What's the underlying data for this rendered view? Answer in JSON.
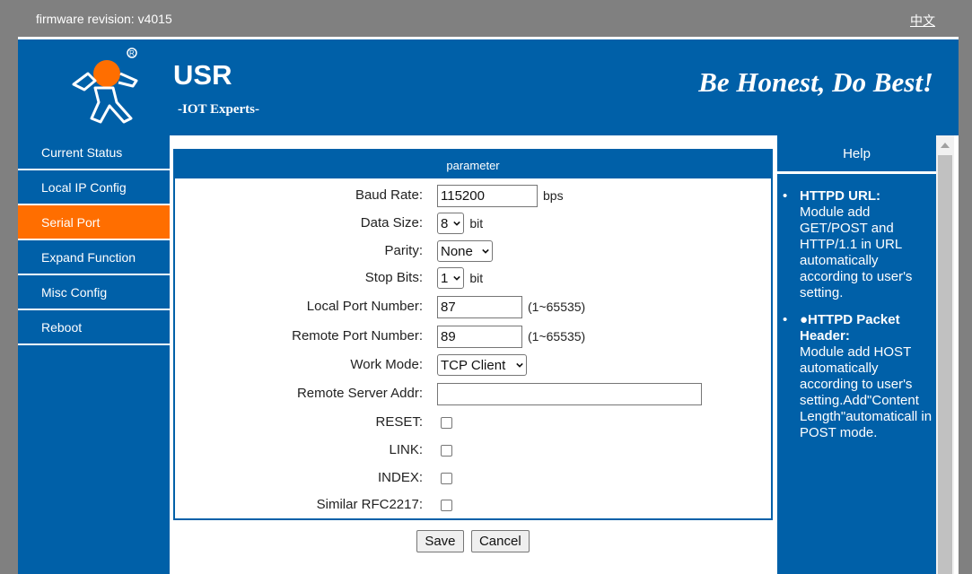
{
  "topbar": {
    "firmware_label": "firmware revision:",
    "firmware_value": "v4015",
    "language_link": "中文"
  },
  "banner": {
    "brand": "USR",
    "tagline": "-IOT Experts-",
    "slogan": "Be Honest, Do Best!",
    "logo_icon": "usr-runner-logo"
  },
  "sidebar": {
    "items": [
      {
        "label": "Current Status",
        "active": false
      },
      {
        "label": "Local IP Config",
        "active": false
      },
      {
        "label": "Serial Port",
        "active": true
      },
      {
        "label": "Expand Function",
        "active": false
      },
      {
        "label": "Misc Config",
        "active": false
      },
      {
        "label": "Reboot",
        "active": false
      }
    ],
    "active_color": "#ff6e00",
    "color": "#0060a8"
  },
  "form": {
    "title": "parameter",
    "baud_rate": {
      "label": "Baud Rate:",
      "value": "115200",
      "unit": "bps"
    },
    "data_size": {
      "label": "Data Size:",
      "value": "8",
      "unit": "bit"
    },
    "parity": {
      "label": "Parity:",
      "value": "None"
    },
    "stop_bits": {
      "label": "Stop Bits:",
      "value": "1",
      "unit": "bit"
    },
    "local_port": {
      "label": "Local Port Number:",
      "value": "87",
      "range": "(1~65535)"
    },
    "remote_port": {
      "label": "Remote Port Number:",
      "value": "89",
      "range": "(1~65535)"
    },
    "work_mode": {
      "label": "Work Mode:",
      "value": "TCP Client"
    },
    "remote_server": {
      "label": "Remote Server Addr:",
      "value": ""
    },
    "reset": {
      "label": "RESET:",
      "checked": false
    },
    "link": {
      "label": "LINK:",
      "checked": false
    },
    "index": {
      "label": "INDEX:",
      "checked": false
    },
    "rfc2217": {
      "label": "Similar RFC2217:",
      "checked": false
    },
    "save_label": "Save",
    "cancel_label": "Cancel"
  },
  "help": {
    "title": "Help",
    "items": [
      {
        "title": "HTTPD URL:",
        "body": "Module add GET/POST and HTTP/1.1 in URL automatically according to user's setting."
      },
      {
        "title": "●HTTPD Packet Header:",
        "body": "Module add HOST automatically according to user's setting.Add\"Content Length\"automaticall in POST mode."
      }
    ]
  }
}
